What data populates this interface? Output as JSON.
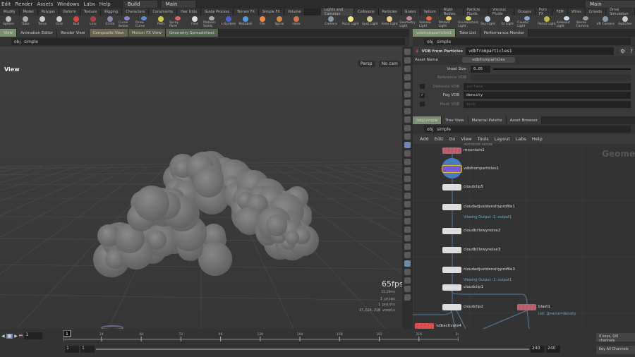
{
  "menu": [
    "Edit",
    "Render",
    "Assets",
    "Windows",
    "Labs",
    "Help"
  ],
  "desktop": {
    "build": "Build",
    "main": "Main",
    "right_main": "Main"
  },
  "shelf_tabs_left": [
    "Modify",
    "Model",
    "Polygon",
    "Deform",
    "Texture",
    "Rigging",
    "Characters",
    "Constraints",
    "Hair Utils",
    "Guide Process",
    "Terrain FX",
    "Simple FX",
    "Volume"
  ],
  "shelf_tabs_right": [
    "Lights and Cameras",
    "Collisions",
    "Particles",
    "Grains",
    "Vellum",
    "Rigid Bodies",
    "Particle Fluids",
    "Viscous Fluids",
    "Oceans",
    "Pyro FX",
    "FEM",
    "Wires",
    "Crowds",
    "Drive Simulation"
  ],
  "tools_left": [
    "Sphere",
    "Tube",
    "Torus",
    "Grid",
    "Null",
    "Line",
    "Circle",
    "Curve Bezier",
    "Draw Curve",
    "Path",
    "Spray Paint",
    "Font",
    "Platonic Solids",
    "L-System",
    "Metaball",
    "File",
    "Spiral",
    "Helix"
  ],
  "tools_right": [
    "Camera",
    "Point Light",
    "Spot Light",
    "Area Light",
    "Geometry Light",
    "Volume Light",
    "Distant Light",
    "Environment Light",
    "Sky Light",
    "GI Light",
    "Caustic Light",
    "Portal Light",
    "Ambient Light",
    "Stereo Camera",
    "VR Camera",
    "Switcher"
  ],
  "left_tabs": [
    "View",
    "Animation Editor",
    "Render View",
    "Composite View",
    "Motion FX View",
    "Geometry Spreadsheet"
  ],
  "right_tabs": [
    "vdbfromparticles1",
    "Take List",
    "Performance Monitor"
  ],
  "path": {
    "obj": "obj",
    "node": "simple"
  },
  "viewport": {
    "title": "View",
    "persp": "Persp",
    "cam": "No cam",
    "fps": "65fps",
    "ms": "15.29ms",
    "prims": "1  prims",
    "points": "1  points",
    "voxels": "17,624,318 voxels"
  },
  "params": {
    "type": "VDB from Particles",
    "name": "vdbfromparticles1",
    "asset_label": "Asset Name",
    "asset_value": "vdbfromparticles",
    "rows": [
      {
        "label": "Voxel Size",
        "value": "0.05",
        "check": null
      },
      {
        "label": "Reference VDB",
        "value": "",
        "check": null
      },
      {
        "label": "Distance VDB",
        "value": "surface",
        "check": false
      },
      {
        "label": "Fog VDB",
        "value": "density",
        "check": true
      },
      {
        "label": "Mask VDB",
        "value": "mask",
        "check": false
      }
    ]
  },
  "net_tabs": [
    "/obj/simple",
    "Tree View",
    "Material Palette",
    "Asset Browser"
  ],
  "net_menu": [
    "Add",
    "Edit",
    "Go",
    "View",
    "Tools",
    "Layout",
    "Labs",
    "Help"
  ],
  "net_watermark": "Geome",
  "nodes": [
    {
      "name": "mountain1",
      "type": "Attribute Noise",
      "color": "#c06070",
      "sub": ""
    },
    {
      "name": "vdbfromparticles1",
      "color": "#7a5ad8",
      "sub": ""
    },
    {
      "name": "cloudclip5",
      "color": "#ddd",
      "sub": ""
    },
    {
      "name": "cloudadjustdensityprofile1",
      "color": "#ddd",
      "sub": "Viewing Output -1: output1"
    },
    {
      "name": "cloudbillowynoise2",
      "color": "#ddd",
      "sub": ""
    },
    {
      "name": "cloudbillowynoise3",
      "color": "#ddd",
      "sub": ""
    },
    {
      "name": "cloudadjustdensityprofile3",
      "color": "#ddd",
      "sub": "Viewing Output -1: output1"
    },
    {
      "name": "cloudclip1",
      "color": "#ddd",
      "sub": ""
    },
    {
      "name": "cloudclip2",
      "color": "#ddd",
      "sub": ""
    },
    {
      "name": "blast1",
      "color": "#c06070",
      "sub": "not: @name=density"
    },
    {
      "name": "vdbactivate4",
      "color": "#e05050",
      "sub": ""
    }
  ],
  "timeline": {
    "frame": "1",
    "start": "1",
    "start2": "1",
    "end": "240",
    "end2": "240",
    "ticks": [
      "1",
      "24",
      "48",
      "72",
      "96",
      "120",
      "144",
      "168",
      "192",
      "216",
      "240"
    ],
    "keys": "0 keys, 0/0 channels",
    "key_all": "Key All Channels"
  }
}
